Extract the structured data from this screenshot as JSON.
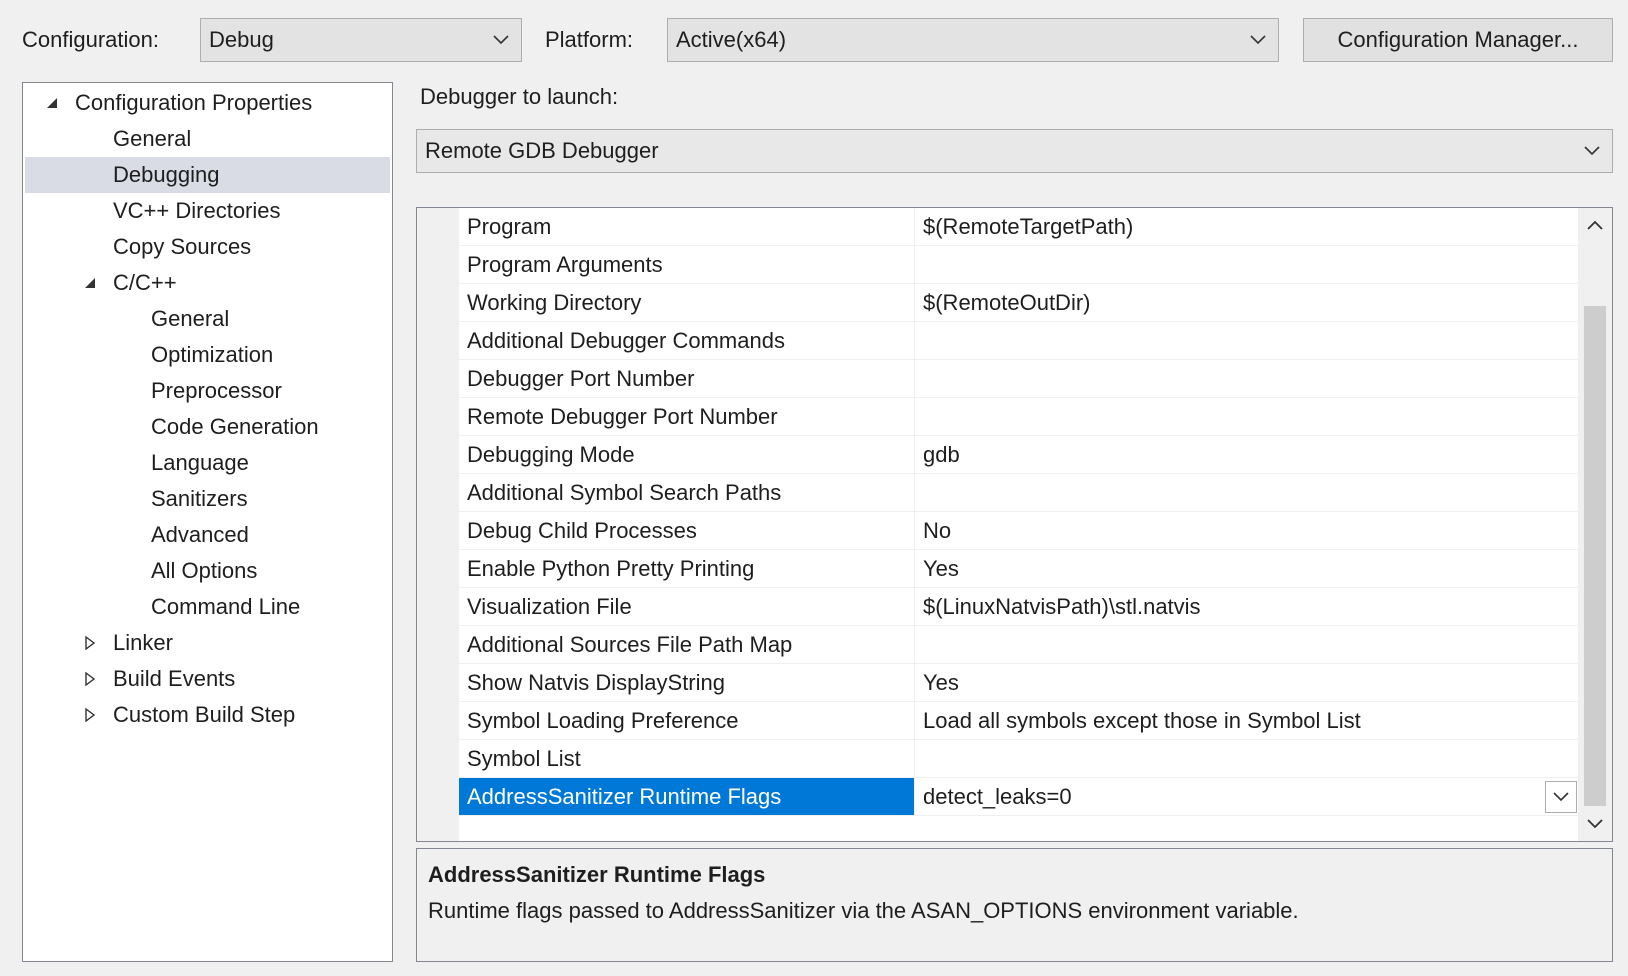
{
  "toolbar": {
    "configuration_label": "Configuration:",
    "configuration_value": "Debug",
    "platform_label": "Platform:",
    "platform_value": "Active(x64)",
    "config_manager_button": "Configuration Manager..."
  },
  "tree": {
    "items": [
      {
        "label": "Configuration Properties",
        "expanded": true
      },
      {
        "label": "General"
      },
      {
        "label": "Debugging",
        "selected": true
      },
      {
        "label": "VC++ Directories"
      },
      {
        "label": "Copy Sources"
      },
      {
        "label": "C/C++",
        "expanded": true
      },
      {
        "label": "General"
      },
      {
        "label": "Optimization"
      },
      {
        "label": "Preprocessor"
      },
      {
        "label": "Code Generation"
      },
      {
        "label": "Language"
      },
      {
        "label": "Sanitizers"
      },
      {
        "label": "Advanced"
      },
      {
        "label": "All Options"
      },
      {
        "label": "Command Line"
      },
      {
        "label": "Linker",
        "expanded": false
      },
      {
        "label": "Build Events",
        "expanded": false
      },
      {
        "label": "Custom Build Step",
        "expanded": false
      }
    ]
  },
  "debugger": {
    "label": "Debugger to launch:",
    "value": "Remote GDB Debugger"
  },
  "properties": [
    {
      "name": "Program",
      "value": "$(RemoteTargetPath)"
    },
    {
      "name": "Program Arguments",
      "value": ""
    },
    {
      "name": "Working Directory",
      "value": "$(RemoteOutDir)"
    },
    {
      "name": "Additional Debugger Commands",
      "value": ""
    },
    {
      "name": "Debugger Port Number",
      "value": ""
    },
    {
      "name": "Remote Debugger Port Number",
      "value": ""
    },
    {
      "name": "Debugging Mode",
      "value": "gdb"
    },
    {
      "name": "Additional Symbol Search Paths",
      "value": ""
    },
    {
      "name": "Debug Child Processes",
      "value": "No"
    },
    {
      "name": "Enable Python Pretty Printing",
      "value": "Yes"
    },
    {
      "name": "Visualization File",
      "value": "$(LinuxNatvisPath)\\stl.natvis"
    },
    {
      "name": "Additional Sources File Path Map",
      "value": ""
    },
    {
      "name": "Show Natvis DisplayString",
      "value": "Yes"
    },
    {
      "name": "Symbol Loading Preference",
      "value": "Load all symbols except those in Symbol List"
    },
    {
      "name": "Symbol List",
      "value": ""
    },
    {
      "name": "AddressSanitizer Runtime Flags",
      "value": "detect_leaks=0",
      "selected": true
    }
  ],
  "description": {
    "title": "AddressSanitizer Runtime Flags",
    "text": "Runtime flags passed to AddressSanitizer via the ASAN_OPTIONS environment variable."
  },
  "icons": {
    "combo_chevron": "chevron-down-icon",
    "tree_expanded": "triangle-expanded-icon",
    "tree_collapsed": "triangle-collapsed-icon",
    "scroll_up": "chevron-up-icon",
    "scroll_down": "chevron-down-icon"
  },
  "colors": {
    "selection_blue": "#0078d7",
    "tree_selection": "#d9dce5",
    "background": "#f0f0f0"
  }
}
